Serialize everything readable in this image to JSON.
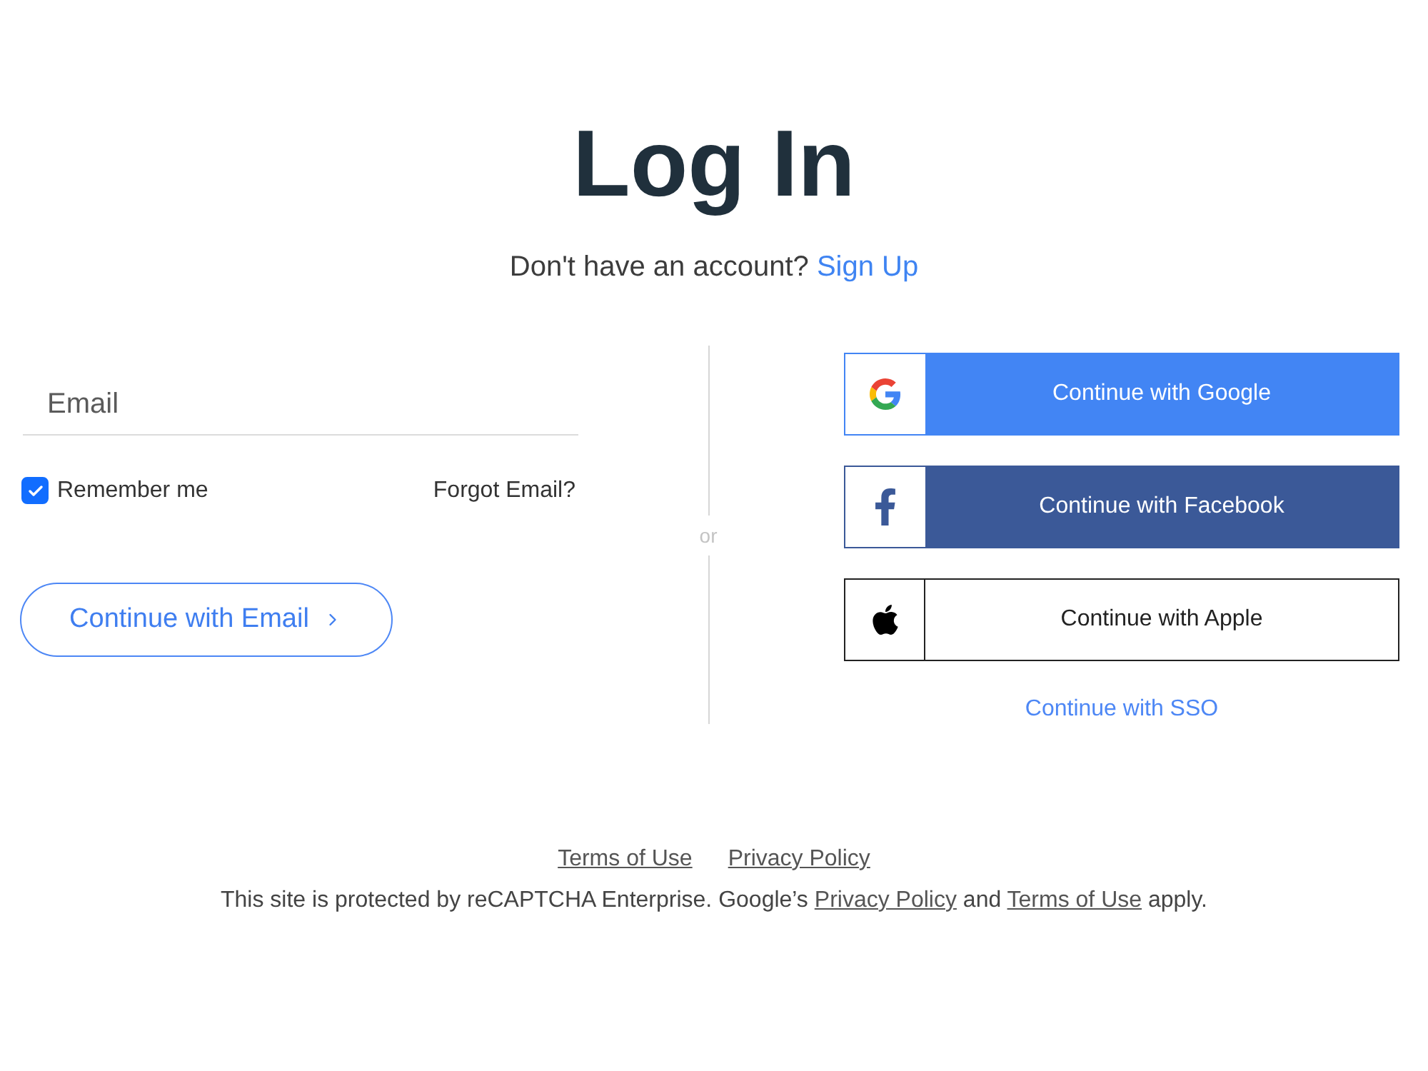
{
  "title": "Log In",
  "signup_prompt": {
    "text": "Don't have an account?",
    "link": "Sign Up"
  },
  "email_form": {
    "email_field": {
      "placeholder": "Email"
    },
    "remember_me": {
      "label": "Remember me",
      "checked": true
    },
    "forgot_link": "Forgot Email?",
    "submit_button": "Continue with Email"
  },
  "divider": {
    "label": "or"
  },
  "social_buttons": [
    {
      "kind": "google",
      "label": "Continue with Google"
    },
    {
      "kind": "facebook",
      "label": "Continue with Facebook"
    },
    {
      "kind": "apple",
      "label": "Continue with Apple"
    }
  ],
  "sso_link": "Continue with SSO",
  "footer": {
    "links": [
      "Terms of Use",
      "Privacy Policy"
    ],
    "notice": [
      {
        "kind": "text",
        "text": "This site is protected by reCAPTCHA Enterprise. Google’s"
      },
      {
        "kind": "link",
        "text": "Privacy Policy"
      },
      {
        "kind": "text",
        "text": "and"
      },
      {
        "kind": "link",
        "text": "Terms of Use"
      },
      {
        "kind": "text",
        "text": "apply."
      }
    ]
  }
}
